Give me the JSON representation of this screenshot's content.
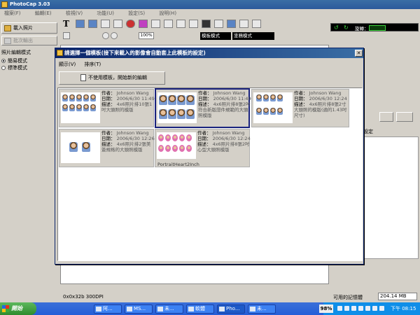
{
  "app": {
    "title": "PhotoCap 3.03",
    "menu": [
      "檔案(F)",
      "編輯(E)",
      "檢視(V)",
      "功能(U)",
      "設定(S)",
      "說明(H)"
    ]
  },
  "left_panel": {
    "load_photo": "載入照片",
    "batch_output": "批次輸出",
    "mode_group_title": "照片編輯模式",
    "mode_simple": "簡易模式",
    "mode_standard": "標準模式"
  },
  "toolbar": {
    "zoom": "100%",
    "template_mode": "模板模式",
    "mosaic_mode": "塗鴉模式"
  },
  "right_panel": {
    "rotate_label": "旋轉：",
    "output_text": "輸出與版面大小設定"
  },
  "status": {
    "left": "0x0x32b  300DPI",
    "memory_label": "可用的記憶體",
    "memory_value": "204.14 MB"
  },
  "dialog": {
    "title": "請選擇一個模板(接下來載入的影像會自動套上此模板的設定)",
    "menu": [
      "顯示(V)",
      "排序(T)"
    ],
    "no_template_button": "不使用模板，開始新的編輯",
    "labels": {
      "author": "作者",
      "date": "日期",
      "desc": "描述"
    },
    "templates": [
      {
        "author": "Johnson Wang",
        "date": "2006/6/30 11:49",
        "desc": "4x6照片排10張1吋大頭照的模版",
        "name": ""
      },
      {
        "author": "Johnson Wang",
        "date": "2006/6/30 11:49",
        "desc": "4x6照片排8張2吋符合新版證件規範的大頭照模版",
        "name": ""
      },
      {
        "author": "Johnson Wang",
        "date": "2006/6/30 12:24",
        "desc": "4x6照片排8張2寸大頭照的模版(適的1.43吋尺寸)",
        "name": ""
      },
      {
        "author": "Johnson Wang",
        "date": "2006/6/30 12:26",
        "desc": "4x6照片排2張美簽規格的大頭照模版",
        "name": ""
      },
      {
        "author": "Johnson Wang",
        "date": "2006/6/30 12:24",
        "desc": "4x6照片排8張2吋心型大頭照模版",
        "name": "PortraitHeart2Inch"
      }
    ]
  },
  "taskbar": {
    "start": "開始",
    "tasks": [
      "阿...",
      "MS...",
      "未...",
      "軟體",
      "Pho...",
      "未..."
    ],
    "battery": "98%",
    "clock": "下午 08:15"
  }
}
